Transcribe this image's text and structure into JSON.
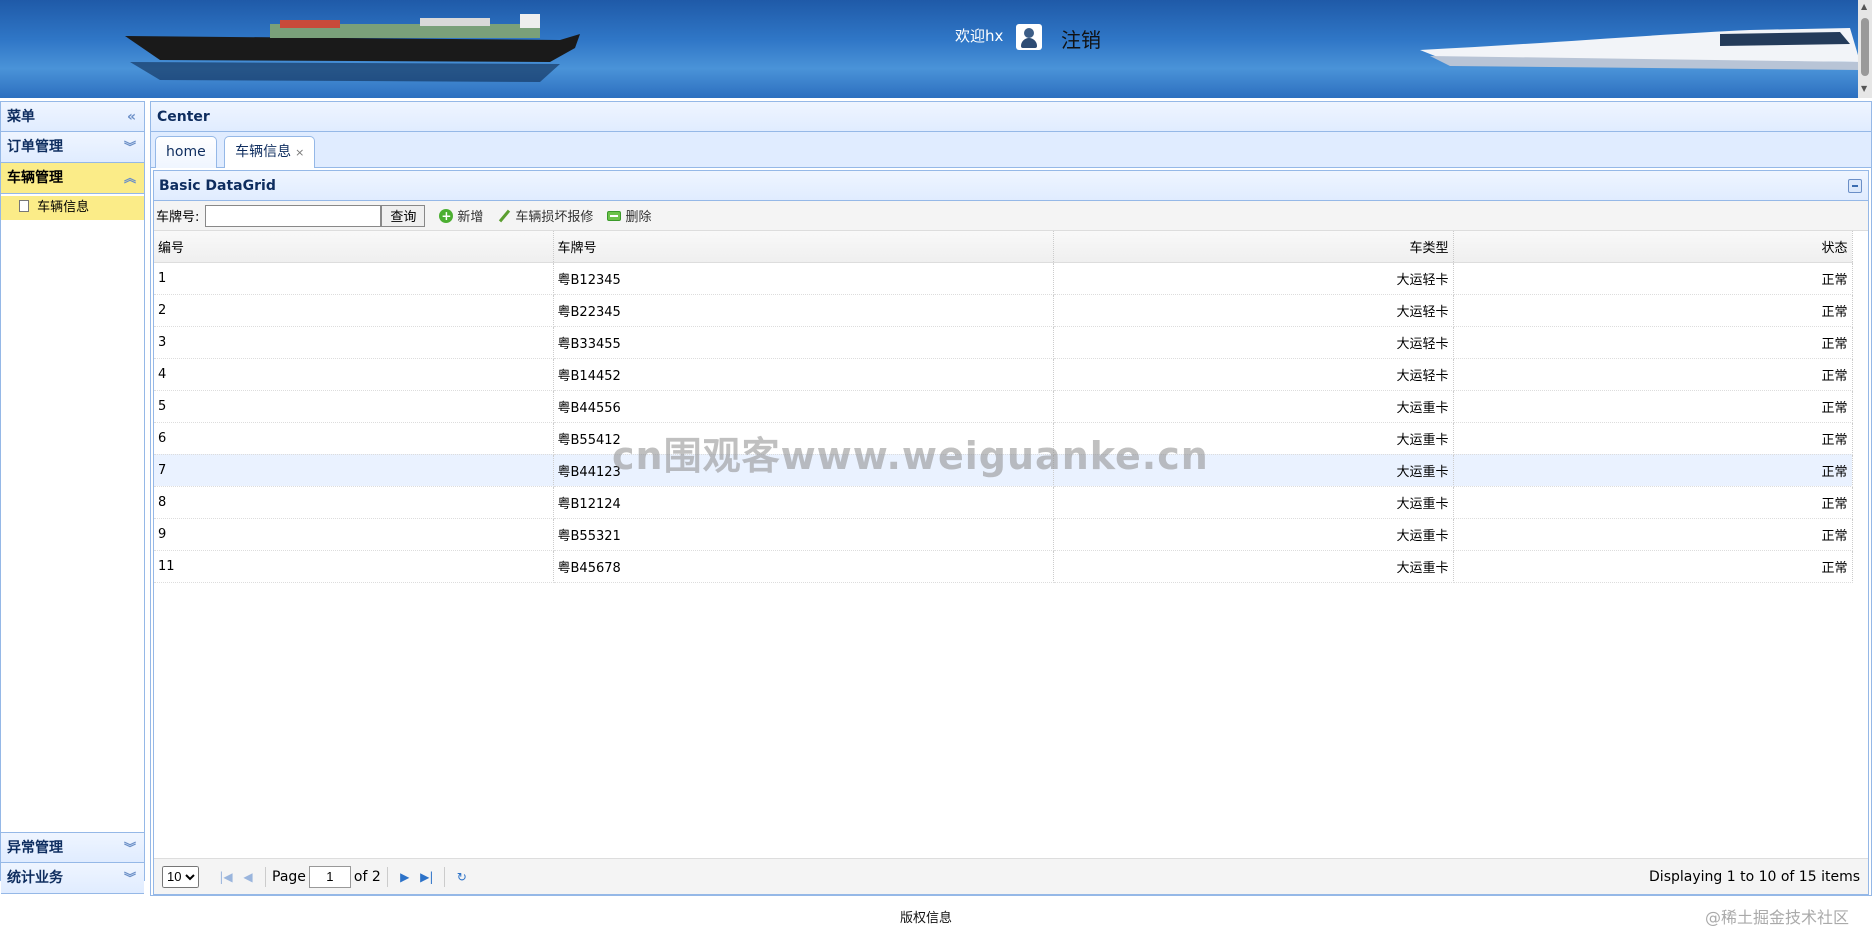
{
  "header": {
    "welcome": "欢迎hx",
    "logout": "注销"
  },
  "west": {
    "title": "菜单",
    "collapse_icon": "double-chevron-left-icon",
    "sections": [
      {
        "label": "订单管理",
        "expanded": false
      },
      {
        "label": "车辆管理",
        "expanded": true,
        "items": [
          "车辆信息"
        ]
      },
      {
        "label": "异常管理",
        "expanded": false
      },
      {
        "label": "统计业务",
        "expanded": false
      }
    ]
  },
  "center": {
    "title": "Center",
    "tabs": [
      {
        "label": "home"
      },
      {
        "label": "车辆信息",
        "closable": true
      }
    ]
  },
  "grid": {
    "title": "Basic DataGrid",
    "toolbar": {
      "plate_label": "车牌号:",
      "plate_value": "",
      "search_label": "查询",
      "add_label": "新增",
      "repair_label": "车辆损坏报修",
      "delete_label": "删除"
    },
    "columns": [
      "编号",
      "车牌号",
      "车类型",
      "状态"
    ],
    "rows": [
      [
        "1",
        "粤B12345",
        "大运轻卡",
        "正常"
      ],
      [
        "2",
        "粤B22345",
        "大运轻卡",
        "正常"
      ],
      [
        "3",
        "粤B33455",
        "大运轻卡",
        "正常"
      ],
      [
        "4",
        "粤B14452",
        "大运轻卡",
        "正常"
      ],
      [
        "5",
        "粤B44556",
        "大运重卡",
        "正常"
      ],
      [
        "6",
        "粤B55412",
        "大运重卡",
        "正常"
      ],
      [
        "7",
        "粤B44123",
        "大运重卡",
        "正常"
      ],
      [
        "8",
        "粤B12124",
        "大运重卡",
        "正常"
      ],
      [
        "9",
        "粤B55321",
        "大运重卡",
        "正常"
      ],
      [
        "11",
        "粤B45678",
        "大运重卡",
        "正常"
      ]
    ],
    "highlighted_row": 6
  },
  "pager": {
    "page_size": "10",
    "page_label": "Page",
    "page": "1",
    "of_label": "of 2",
    "info": "Displaying 1 to 10 of 15 items"
  },
  "footer": {
    "text": "版权信息"
  },
  "watermark": "cn围观客www.weiguanke.cn",
  "brand": "@稀土掘金技术社区"
}
